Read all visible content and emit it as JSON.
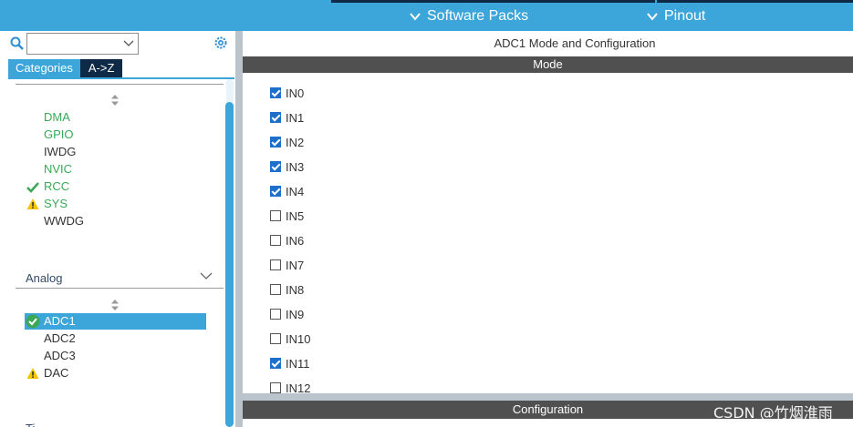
{
  "topbar": {
    "software_packs": "Software Packs",
    "pinout": "Pinout"
  },
  "left": {
    "tabs": [
      "Categories",
      "A->Z"
    ],
    "system_items": [
      {
        "label": "DMA",
        "status": "green"
      },
      {
        "label": "GPIO",
        "status": "green"
      },
      {
        "label": "IWDG",
        "status": "default"
      },
      {
        "label": "NVIC",
        "status": "green"
      },
      {
        "label": "RCC",
        "status": "ok"
      },
      {
        "label": "SYS",
        "status": "warning"
      },
      {
        "label": "WWDG",
        "status": "default"
      }
    ],
    "analog_header": "Analog",
    "analog_items": [
      {
        "label": "ADC1",
        "status": "selected-ok"
      },
      {
        "label": "ADC2",
        "status": "default"
      },
      {
        "label": "ADC3",
        "status": "default"
      },
      {
        "label": "DAC",
        "status": "warning"
      }
    ],
    "next_header": "Ti"
  },
  "right": {
    "title": "ADC1 Mode and Configuration",
    "mode_bar": "Mode",
    "config_bar": "Configuration",
    "channels": [
      {
        "label": "IN0",
        "checked": true
      },
      {
        "label": "IN1",
        "checked": true
      },
      {
        "label": "IN2",
        "checked": true
      },
      {
        "label": "IN3",
        "checked": true
      },
      {
        "label": "IN4",
        "checked": true
      },
      {
        "label": "IN5",
        "checked": false
      },
      {
        "label": "IN6",
        "checked": false
      },
      {
        "label": "IN7",
        "checked": false
      },
      {
        "label": "IN8",
        "checked": false
      },
      {
        "label": "IN9",
        "checked": false
      },
      {
        "label": "IN10",
        "checked": false
      },
      {
        "label": "IN11",
        "checked": true
      },
      {
        "label": "IN12",
        "checked": false
      }
    ]
  },
  "watermark": "CSDN @竹烟淮雨",
  "colors": {
    "accent": "#3ca5d9",
    "dark_navy": "#0e2a47",
    "ok_green": "#3aa857",
    "warning_yellow": "#f5c400",
    "checkbox_blue": "#1e6fc9"
  }
}
